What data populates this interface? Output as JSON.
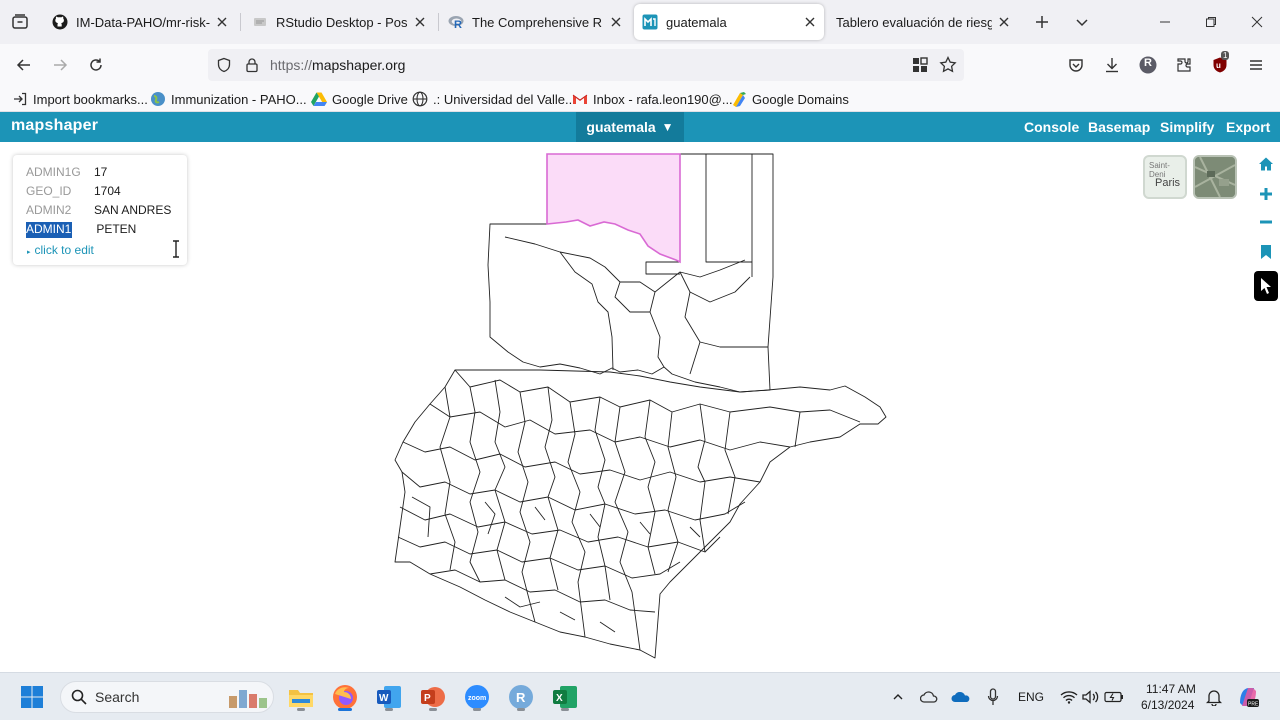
{
  "browser": {
    "tabs": [
      {
        "label": "IM-Data-PAHO/mr-risk-as",
        "favicon": "github-icon",
        "active": false
      },
      {
        "label": "RStudio Desktop - Posit",
        "favicon": "rstudio-icon",
        "active": false
      },
      {
        "label": "The Comprehensive R Arc",
        "favicon": "r-logo-icon",
        "active": false
      },
      {
        "label": "guatemala",
        "favicon": "mapshaper-icon",
        "active": true
      },
      {
        "label": "Tablero evaluación de riesgo",
        "favicon": "",
        "active": false
      }
    ],
    "url_scheme": "https://",
    "url_host": "mapshaper.org",
    "profile_initial": "R",
    "extension_badge": "1",
    "bookmarks": [
      {
        "label": "Import bookmarks...",
        "icon": "import-icon"
      },
      {
        "label": "Immunization - PAHO...",
        "icon": "globe-icon"
      },
      {
        "label": "Google Drive",
        "icon": "google-drive-icon"
      },
      {
        "label": ".: Universidad del Valle...",
        "icon": "globe-icon"
      },
      {
        "label": "Inbox - rafa.leon190@...",
        "icon": "gmail-icon"
      },
      {
        "label": "Google Domains",
        "icon": "google-domains-icon"
      }
    ]
  },
  "mapshaper": {
    "logo": "mapshaper",
    "layer_name": "guatemala",
    "layer_arrow": "▼",
    "menu": [
      "Console",
      "Basemap",
      "Simplify",
      "Export"
    ],
    "info": {
      "rows": [
        {
          "key": "ADMIN1G",
          "value": "17"
        },
        {
          "key": "GEO_ID",
          "value": "1704"
        },
        {
          "key": "ADMIN2",
          "value": "SAN ANDRES"
        },
        {
          "key": "ADMIN1",
          "value": "PETEN"
        }
      ],
      "edit_link": "click to edit"
    },
    "basemap_labels": {
      "top": "Saint-Deni",
      "city": "Paris"
    },
    "selected_fill": "#fbdcf8",
    "selected_stroke": "#d96ad4"
  },
  "taskbar": {
    "search_label": "Search",
    "language": "ENG",
    "time": "11:47 AM",
    "date": "6/13/2024"
  }
}
